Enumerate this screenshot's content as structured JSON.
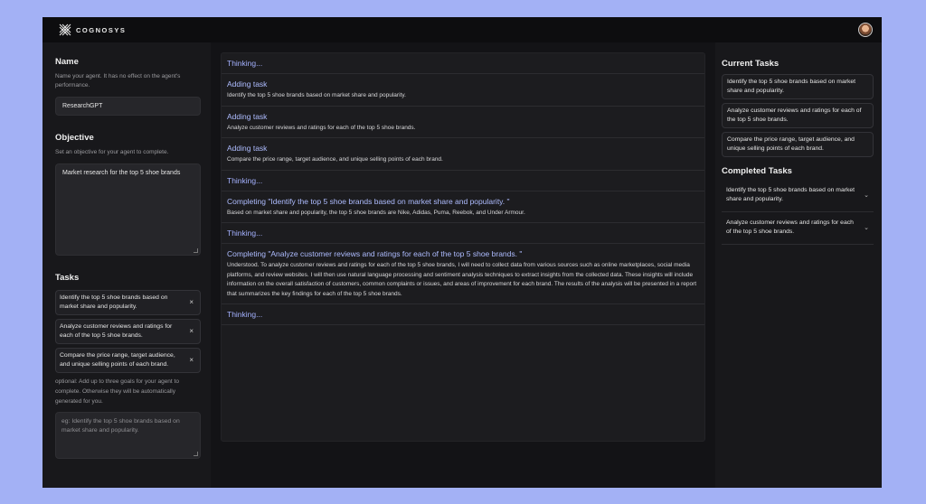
{
  "brand": {
    "name": "COGNOSYS",
    "logo_icon": "cognosys-x-logo"
  },
  "user": {
    "avatar": "user-avatar"
  },
  "left": {
    "name_title": "Name",
    "name_desc": "Name your agent. It has no effect on the agent's performance.",
    "name_value": "ResearchGPT",
    "objective_title": "Objective",
    "objective_desc": "Set an objective for your agent to complete.",
    "objective_value": "Market research for the top 5 shoe brands",
    "tasks_title": "Tasks",
    "tasks": [
      {
        "label": "Identify the top 5 shoe brands based on market share and popularity."
      },
      {
        "label": "Analyze customer reviews and ratings for each of the top 5 shoe brands."
      },
      {
        "label": "Compare the price range, target audience, and unique selling points of each brand."
      }
    ],
    "remove_glyph": "×",
    "optional_text": "optional: Add up to three goals for your agent to complete. Otherwise they will be automatically generated for you.",
    "goal_placeholder": "eg: Identify the top 5 shoe brands based on market share and popularity."
  },
  "feed": [
    {
      "title": "Thinking...",
      "body": ""
    },
    {
      "title": "Adding task",
      "body": "Identify the top 5 shoe brands based on market share and popularity."
    },
    {
      "title": "Adding task",
      "body": "Analyze customer reviews and ratings for each of the top 5 shoe brands."
    },
    {
      "title": "Adding task",
      "body": "Compare the price range, target audience, and unique selling points of each brand."
    },
    {
      "title": "Thinking...",
      "body": ""
    },
    {
      "title": "Completing \"Identify the top 5 shoe brands based on market share and popularity. \"",
      "body": "Based on market share and popularity, the top 5 shoe brands are Nike, Adidas, Puma, Reebok, and Under Armour."
    },
    {
      "title": "Thinking...",
      "body": ""
    },
    {
      "title": "Completing \"Analyze customer reviews and ratings for each of the top 5 shoe brands. \"",
      "body": "Understood. To analyze customer reviews and ratings for each of the top 5 shoe brands, I will need to collect data from various sources such as online marketplaces, social media platforms, and review websites. I will then use natural language processing and sentiment analysis techniques to extract insights from the collected data. These insights will include information on the overall satisfaction of customers, common complaints or issues, and areas of improvement for each brand. The results of the analysis will be presented in a report that summarizes the key findings for each of the top 5 shoe brands."
    },
    {
      "title": "Thinking...",
      "body": ""
    }
  ],
  "right": {
    "current_title": "Current Tasks",
    "current": [
      {
        "label": "Identify the top 5 shoe brands based on market share and popularity."
      },
      {
        "label": "Analyze customer reviews and ratings for each of the top 5 shoe brands."
      },
      {
        "label": "Compare the price range, target audience, and unique selling points of each brand."
      }
    ],
    "completed_title": "Completed Tasks",
    "completed": [
      {
        "label": "Identify the top 5 shoe brands based on market share and popularity."
      },
      {
        "label": "Analyze customer reviews and ratings for each of the top 5 shoe brands."
      }
    ],
    "chevron_glyph": "⌄"
  }
}
